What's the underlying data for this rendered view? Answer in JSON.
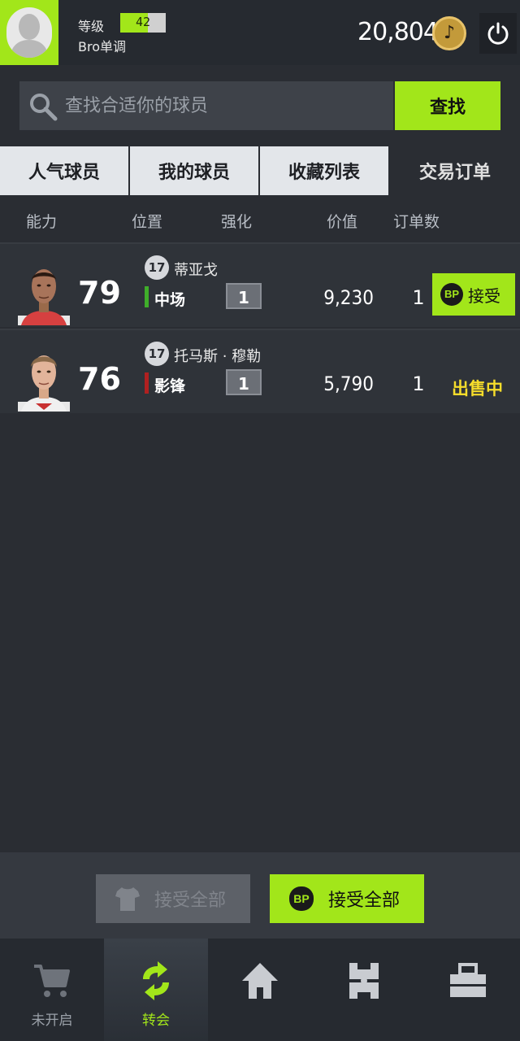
{
  "header": {
    "level_label": "等级",
    "level_value": "42",
    "level_progress": 0.6,
    "username": "Bro单调",
    "coins": "20,804",
    "coin_icon": "music-note-coin-icon",
    "power_icon": "power-icon"
  },
  "search": {
    "placeholder": "查找合适你的球员",
    "button_label": "查找"
  },
  "tabs": [
    {
      "label": "人气球员",
      "active": false
    },
    {
      "label": "我的球员",
      "active": false
    },
    {
      "label": "收藏列表",
      "active": false
    },
    {
      "label": "交易订单",
      "active": true
    }
  ],
  "columns": {
    "ability": "能力",
    "position": "位置",
    "upgrade": "强化",
    "price": "价值",
    "orders": "订单数"
  },
  "rows": [
    {
      "rating": "79",
      "season": "17",
      "name": "蒂亚戈",
      "position": "中场",
      "position_color": "#3fae2a",
      "upgrade": "1",
      "price": "9,230",
      "orders": "1",
      "action": {
        "type": "button",
        "bp": "BP",
        "label": "接受"
      }
    },
    {
      "rating": "76",
      "season": "17",
      "name": "托马斯 · 穆勒",
      "position": "影锋",
      "position_color": "#b02020",
      "upgrade": "1",
      "price": "5,790",
      "orders": "1",
      "action": {
        "type": "status",
        "label": "出售中"
      }
    }
  ],
  "actions": {
    "accept_all_disabled": "接受全部",
    "accept_all_bp_badge": "BP",
    "accept_all_bp": "接受全部"
  },
  "nav": [
    {
      "icon": "cart-icon",
      "label": "未开启",
      "active": false
    },
    {
      "icon": "transfer-icon",
      "label": "转会",
      "active": true
    },
    {
      "icon": "home-icon",
      "label": "",
      "active": false
    },
    {
      "icon": "pitch-icon",
      "label": "",
      "active": false
    },
    {
      "icon": "bag-icon",
      "label": "",
      "active": false
    }
  ],
  "colors": {
    "accent": "#a2e61a",
    "background": "#2a2d33",
    "selling": "#f6dd2b"
  }
}
